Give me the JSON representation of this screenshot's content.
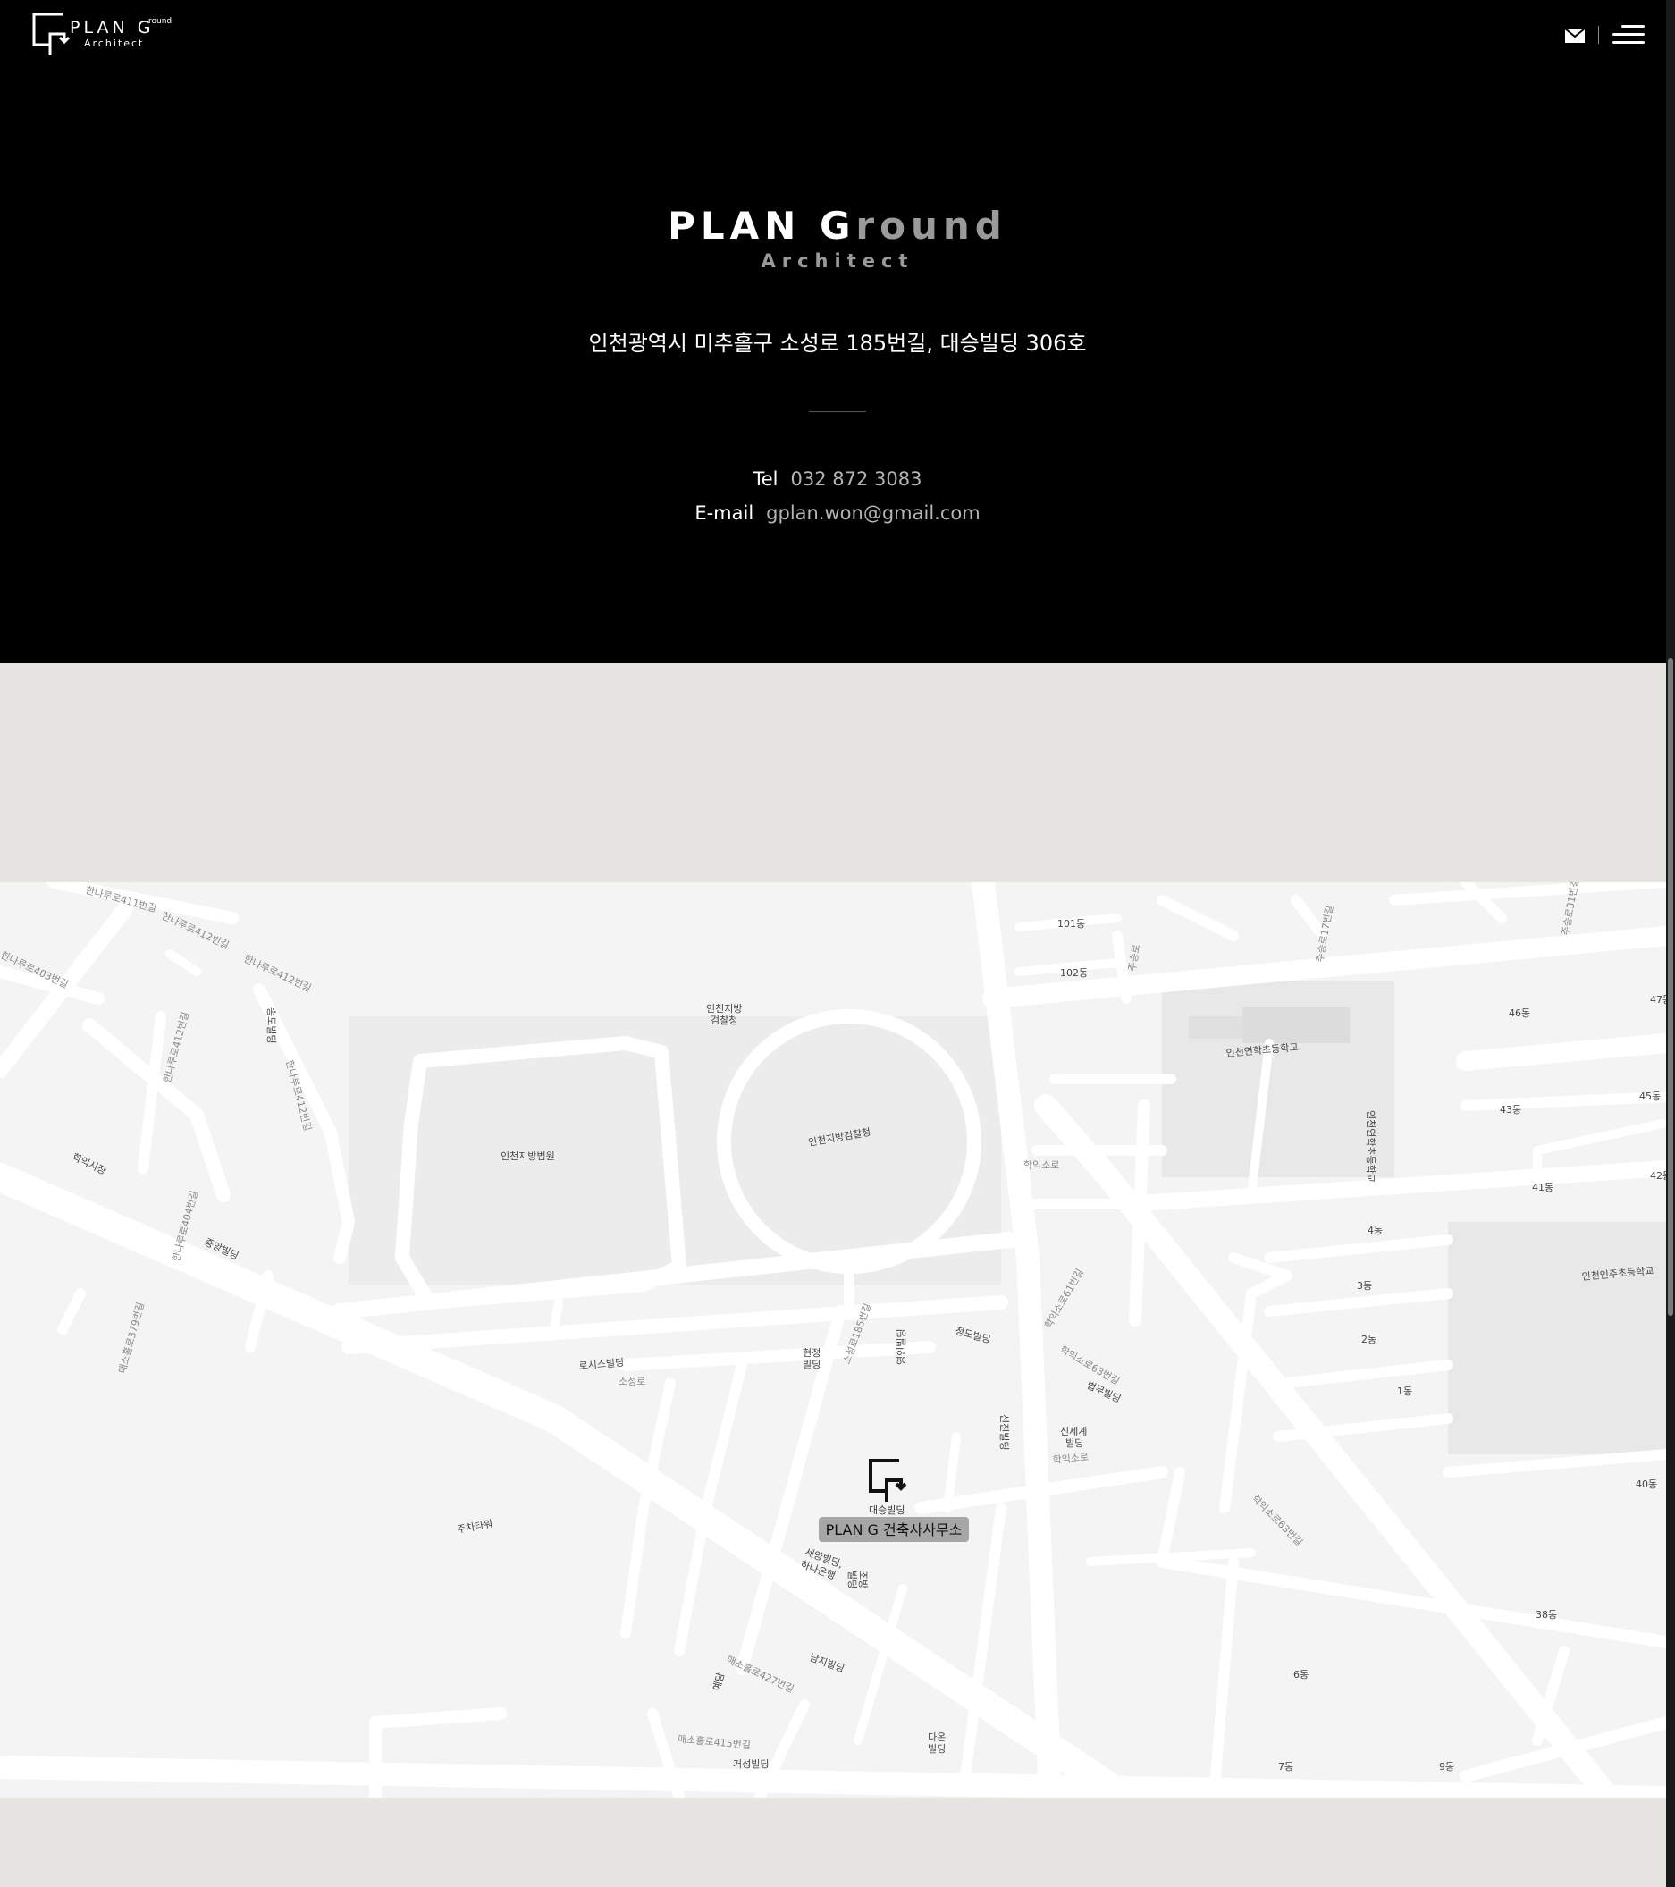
{
  "header": {
    "logo_title": "PLAN G",
    "logo_sup": "round",
    "logo_sub": "Architect",
    "mail_icon": "mail-icon",
    "menu_icon": "hamburger-menu-icon"
  },
  "hero": {
    "title_part1": "PLAN G",
    "title_part2": "round",
    "subtitle": "Architect",
    "address": "인천광역시 미추홀구 소성로 185번길, 대승빌딩 306호",
    "tel_label": "Tel",
    "tel_value": "032 872 3083",
    "email_label": "E-mail",
    "email_value": "gplan.won@gmail.com"
  },
  "map": {
    "marker_label": "PLAN G 건축사사무소",
    "marker_building": "대승빌딩",
    "labels": {
      "court": "인천지방법원",
      "prosecutor": "인천지방검찰청",
      "prosecutor_top": "인천지방",
      "prosecutor_top2": "검찰청",
      "school1": "인천연학초등학교",
      "school2": "인천인주초등학교",
      "school3": "인천연학초등학교",
      "hakik_market": "학익시장",
      "jungang": "중앙빌딩",
      "rosis": "로시스빌딩",
      "sosungro": "소성로",
      "sosungro185": "소성로185번길",
      "hakikso": "학익소로",
      "hakikso63": "학익소로63번길",
      "hakikso61": "학익소로61번길",
      "hakikso_b": "학익소로",
      "hakikso63b": "학익소로63번길",
      "hyunjung": "현정",
      "building": "빌딩",
      "jungdo": "정도빌딩",
      "younginbld": "영인빌딩",
      "shinjin": "신진빌딩",
      "bupmu": "법무빌딩",
      "shinsegye": "신세계",
      "shinsegye2": "빌딩",
      "parking": "주차타워",
      "saeyang": "세양빌딩,",
      "hana": "하나은행",
      "jobang": "조방",
      "bld2": "빌딩",
      "namji": "남지빌딩",
      "dareun": "다온",
      "dareun2": "빌딩",
      "geosung": "거성빌딩",
      "maesohol415": "매소홀로415번길",
      "maesohol427": "매소홀로427번길",
      "maesohol379": "매소홀로379번길",
      "hannuro412a": "한나루로412번길",
      "hannuro412b": "한나루로412번길",
      "hannuro412c": "한나루로412번길",
      "hannuro412d": "한나루로412번길",
      "hannuro403": "한나루로403번길",
      "hannuro404": "한나루로404번길",
      "hannuro411": "한나루로411번길",
      "songdo": "송도빌딩",
      "jueungro": "주승로",
      "jueungro17": "주승로17번길",
      "jueungro31": "주승로31번길",
      "d101": "101동",
      "d102": "102동",
      "d46": "46동",
      "d47": "47동",
      "d43": "43동",
      "d45": "45동",
      "d41": "41동",
      "d42": "42동",
      "d4": "4동",
      "d3": "3동",
      "d2": "2동",
      "d1": "1동",
      "d40": "40동",
      "d38": "38동",
      "d6": "6동",
      "d7": "7동",
      "d9": "9동",
      "yedam": "예담"
    }
  }
}
